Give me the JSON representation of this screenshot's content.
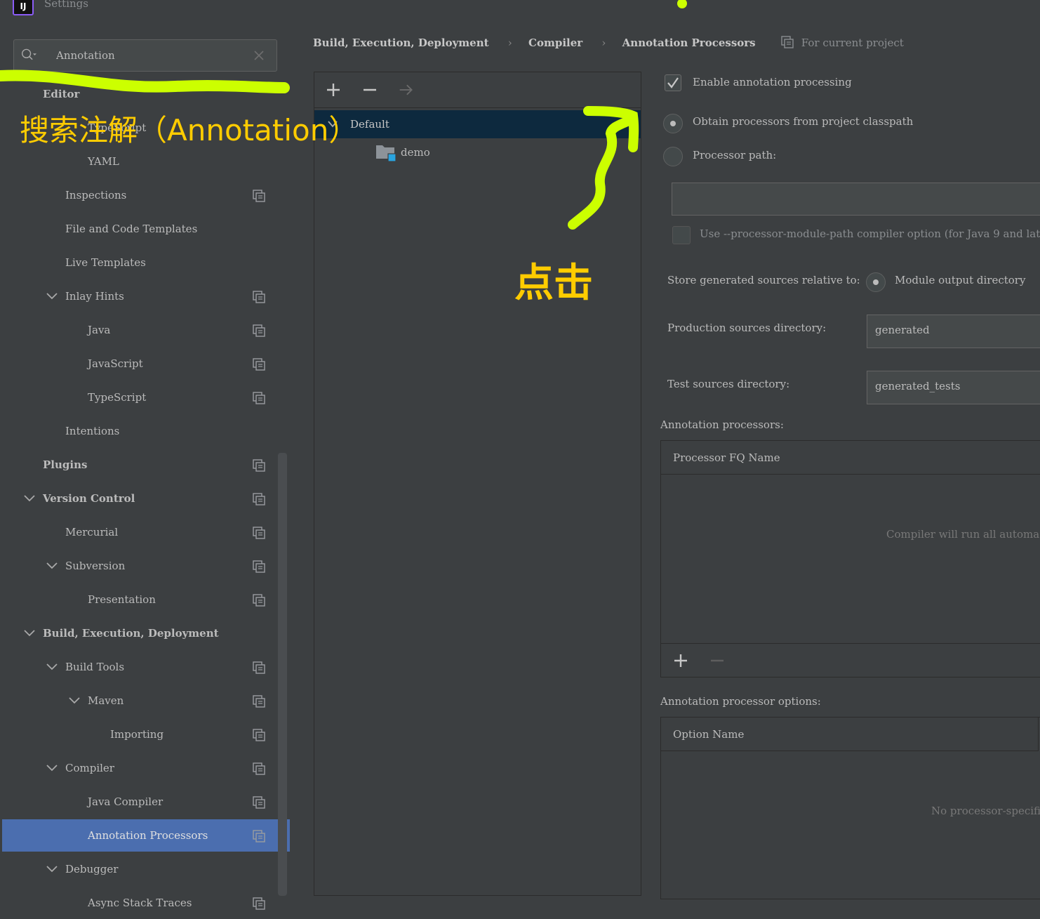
{
  "window": {
    "title": "Settings",
    "logo_text": "IJ"
  },
  "search": {
    "value": "Annotation"
  },
  "sidebar": {
    "items": [
      {
        "label": "Editor",
        "bold": true,
        "indent": 0,
        "chevron": false,
        "copy": false
      },
      {
        "label": "TypeScript",
        "indent": 2,
        "chevron": false,
        "copy": false
      },
      {
        "label": "YAML",
        "indent": 2,
        "chevron": false,
        "copy": false
      },
      {
        "label": "Inspections",
        "indent": 1,
        "chevron": false,
        "copy": true
      },
      {
        "label": "File and Code Templates",
        "indent": 1,
        "chevron": false,
        "copy": false
      },
      {
        "label": "Live Templates",
        "indent": 1,
        "chevron": false,
        "copy": false
      },
      {
        "label": "Inlay Hints",
        "indent": 1,
        "chevron": true,
        "copy": true
      },
      {
        "label": "Java",
        "indent": 2,
        "chevron": false,
        "copy": true
      },
      {
        "label": "JavaScript",
        "indent": 2,
        "chevron": false,
        "copy": true
      },
      {
        "label": "TypeScript",
        "indent": 2,
        "chevron": false,
        "copy": true
      },
      {
        "label": "Intentions",
        "indent": 1,
        "chevron": false,
        "copy": false
      },
      {
        "label": "Plugins",
        "bold": true,
        "indent": 0,
        "chevron": false,
        "copy": true
      },
      {
        "label": "Version Control",
        "bold": true,
        "indent": 0,
        "chevron": true,
        "copy": true
      },
      {
        "label": "Mercurial",
        "indent": 1,
        "chevron": false,
        "copy": true
      },
      {
        "label": "Subversion",
        "indent": 1,
        "chevron": true,
        "copy": true
      },
      {
        "label": "Presentation",
        "indent": 2,
        "chevron": false,
        "copy": true
      },
      {
        "label": "Build, Execution, Deployment",
        "bold": true,
        "indent": 0,
        "chevron": true,
        "copy": false
      },
      {
        "label": "Build Tools",
        "indent": 1,
        "chevron": true,
        "copy": true
      },
      {
        "label": "Maven",
        "indent": 2,
        "chevron": true,
        "copy": true
      },
      {
        "label": "Importing",
        "indent": 3,
        "chevron": false,
        "copy": true
      },
      {
        "label": "Compiler",
        "indent": 1,
        "chevron": true,
        "copy": true
      },
      {
        "label": "Java Compiler",
        "indent": 2,
        "chevron": false,
        "copy": true
      },
      {
        "label": "Annotation Processors",
        "indent": 2,
        "chevron": false,
        "copy": true,
        "selected": true
      },
      {
        "label": "Debugger",
        "indent": 1,
        "chevron": true,
        "copy": false
      },
      {
        "label": "Async Stack Traces",
        "indent": 2,
        "chevron": false,
        "copy": true
      }
    ]
  },
  "breadcrumb": {
    "items": [
      "Build, Execution, Deployment",
      "Compiler",
      "Annotation Processors"
    ],
    "separator": "›",
    "scope_label": "For current project"
  },
  "profiles": {
    "default_label": "Default",
    "module_label": "demo"
  },
  "form": {
    "enable_label": "Enable annotation processing",
    "enable_checked": true,
    "obtain_label": "Obtain processors from project classpath",
    "obtain_selected": true,
    "processor_path_label": "Processor path:",
    "processor_path_value": "",
    "module_path_label": "Use --processor-module-path compiler option (for Java 9 and lat",
    "store_label": "Store generated sources relative to:",
    "module_output_label": "Module output directory",
    "production_label": "Production sources directory:",
    "production_value": "generated",
    "test_label": "Test sources directory:",
    "test_value": "generated_tests",
    "processors_label": "Annotation processors:",
    "processors_header": "Processor FQ Name",
    "processors_empty": "Compiler will run all automa",
    "options_label": "Annotation processor options:",
    "options_header": "Option Name",
    "options_empty": "No processor-specific"
  },
  "annotations": {
    "search_note": "搜索注解（Annotation）",
    "click_note": "点击",
    "color": "#ccff00",
    "text_color": "#ffcc00"
  },
  "colors": {
    "background": "#3c3f41",
    "selection": "#4b6eaf",
    "profile_selection": "#0d293e"
  }
}
